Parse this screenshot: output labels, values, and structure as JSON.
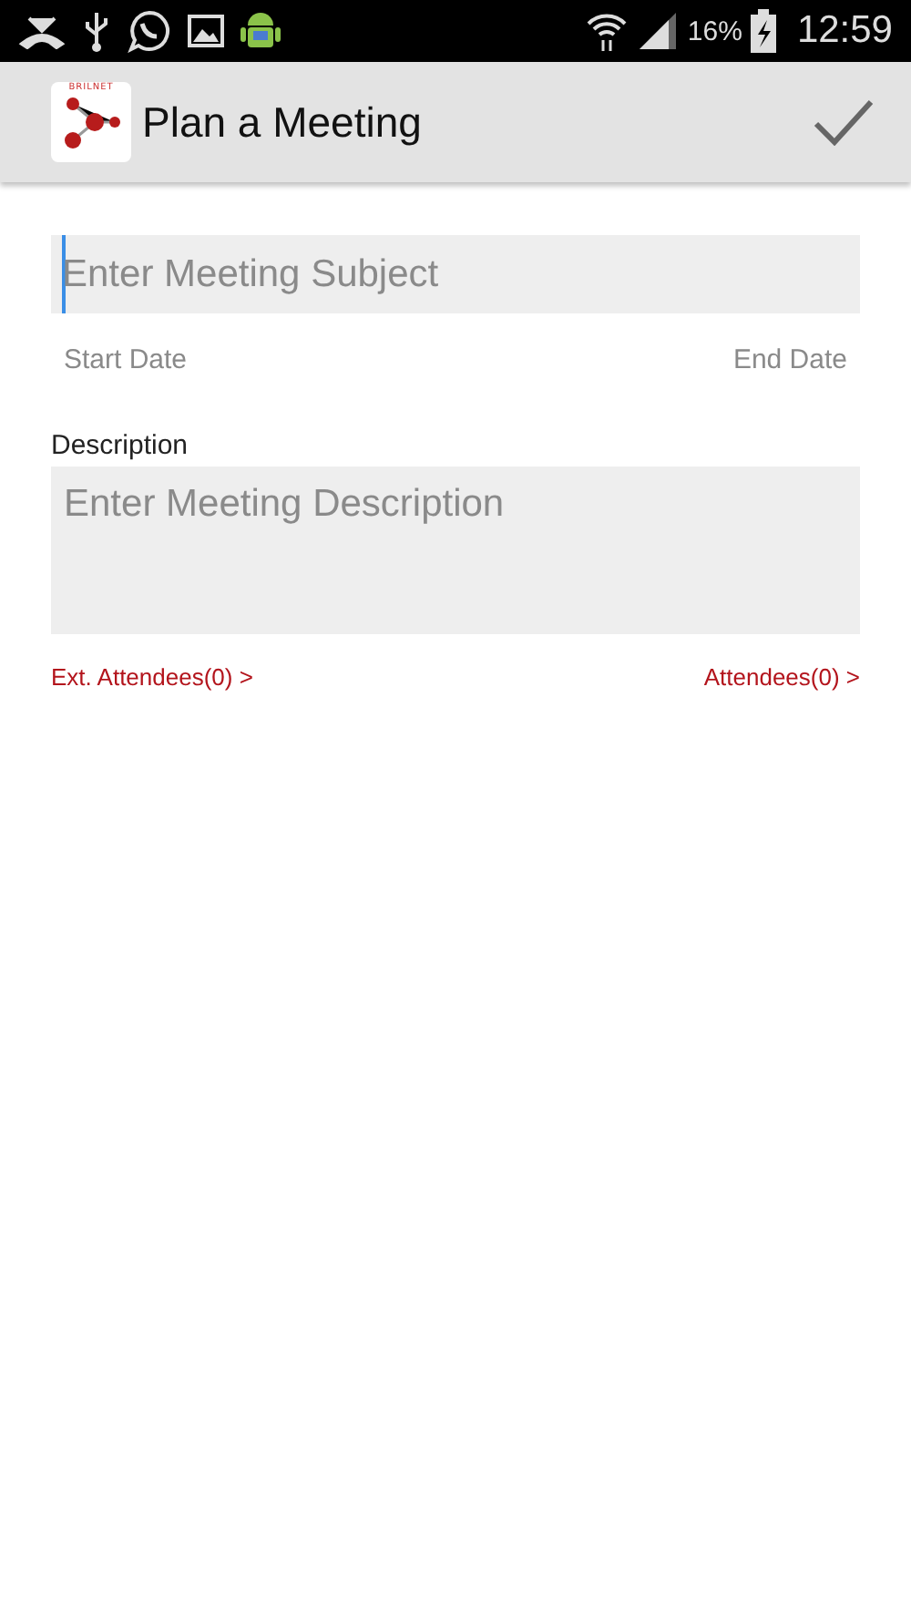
{
  "status_bar": {
    "battery": "16%",
    "time": "12:59"
  },
  "action_bar": {
    "logo_text": "BRILNET",
    "title": "Plan a Meeting"
  },
  "subject": {
    "placeholder": "Enter Meeting Subject",
    "focused": true
  },
  "dates": {
    "start": "Start Date",
    "end": "End Date"
  },
  "description": {
    "label": "Description",
    "placeholder": "Enter Meeting Description"
  },
  "links": {
    "external": "Ext. Attendees(0) >",
    "internal": "Attendees(0) >"
  }
}
